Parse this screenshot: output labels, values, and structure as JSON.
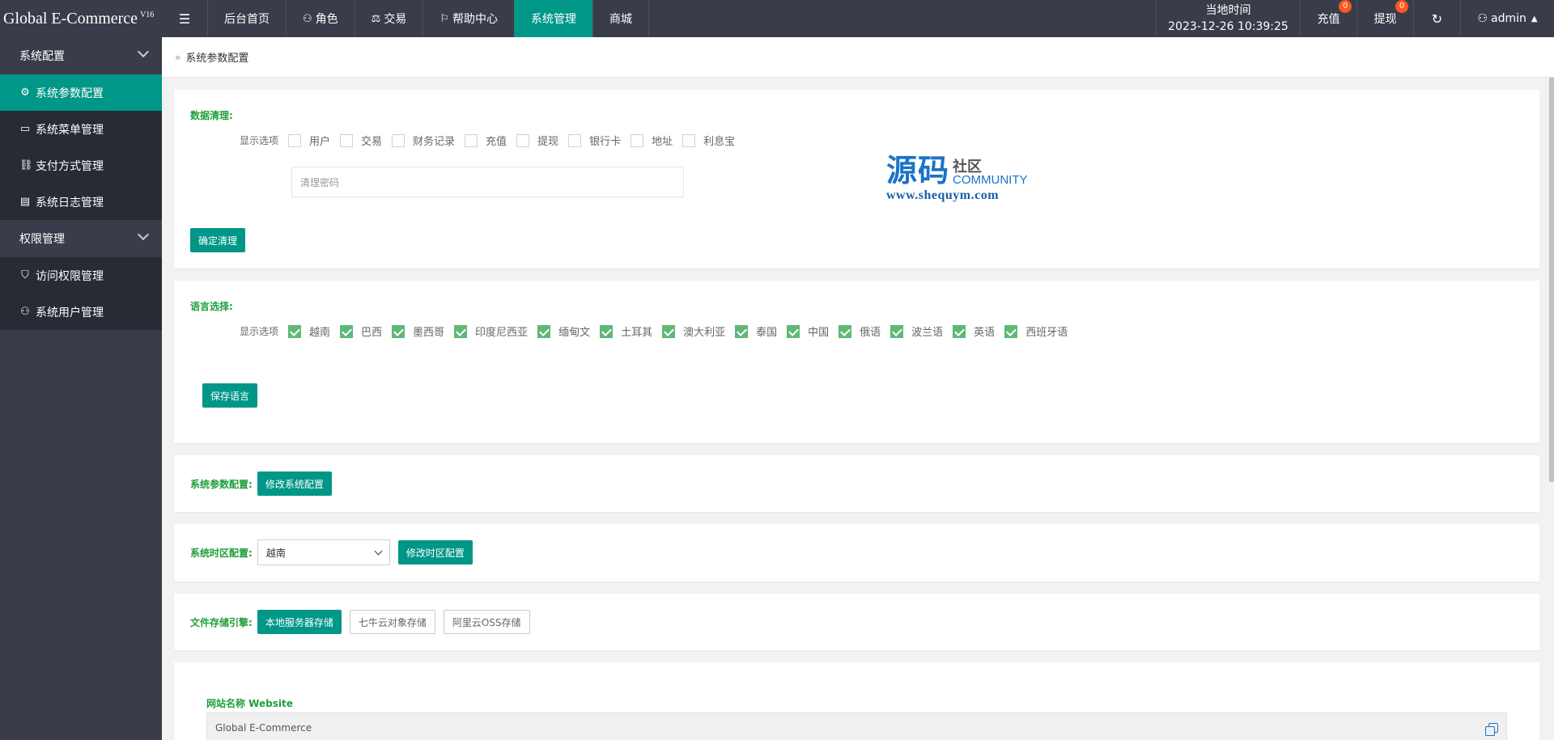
{
  "header": {
    "brand": "Global E-Commerce",
    "version": "V16",
    "toggle_icon": "☰",
    "nav": [
      {
        "label": "后台首页",
        "icon": ""
      },
      {
        "label": "角色",
        "icon": "user-icon"
      },
      {
        "label": "交易",
        "icon": "scale-icon"
      },
      {
        "label": "帮助中心",
        "icon": "flag-icon"
      },
      {
        "label": "系统管理",
        "icon": "",
        "active": true
      },
      {
        "label": "商城",
        "icon": ""
      }
    ],
    "clock_label": "当地时间",
    "clock_value": "2023-12-26 10:39:25",
    "recharge_label": "充值",
    "recharge_badge": "0",
    "withdraw_label": "提现",
    "withdraw_badge": "0",
    "user": "admin"
  },
  "sidebar": {
    "groups": [
      {
        "label": "系统配置",
        "items": [
          {
            "label": "系统参数配置",
            "icon": "gear-icon",
            "active": true
          },
          {
            "label": "系统菜单管理",
            "icon": "window-icon"
          },
          {
            "label": "支付方式管理",
            "icon": "link-icon"
          },
          {
            "label": "系统日志管理",
            "icon": "document-icon"
          }
        ]
      },
      {
        "label": "权限管理",
        "items": [
          {
            "label": "访问权限管理",
            "icon": "shield-icon"
          },
          {
            "label": "系统用户管理",
            "icon": "user-icon"
          }
        ]
      }
    ]
  },
  "breadcrumb": {
    "sep": "»",
    "current": "系统参数配置"
  },
  "data_clear": {
    "title": "数据清理:",
    "options_label": "显示选项",
    "options": [
      "用户",
      "交易",
      "财务记录",
      "充值",
      "提现",
      "银行卡",
      "地址",
      "利息宝"
    ],
    "password_placeholder": "清理密码",
    "confirm_button": "确定清理"
  },
  "watermark": {
    "big": "源码",
    "cn": "社区",
    "en": "COMMUNITY",
    "url": "www.shequym.com"
  },
  "language": {
    "title": "语言选择:",
    "options_label": "显示选项",
    "options": [
      "越南",
      "巴西",
      "墨西哥",
      "印度尼西亚",
      "缅甸文",
      "土耳其",
      "澳大利亚",
      "泰国",
      "中国",
      "俄语",
      "波兰语",
      "英语",
      "西班牙语"
    ],
    "save_button": "保存语言"
  },
  "system_params": {
    "title": "系统参数配置:",
    "button": "修改系统配置"
  },
  "timezone": {
    "title": "系统时区配置:",
    "selected": "越南",
    "button": "修改时区配置"
  },
  "storage": {
    "title": "文件存储引擎:",
    "options": [
      "本地服务器存储",
      "七牛云对象存储",
      "阿里云OSS存储"
    ]
  },
  "website": {
    "label": "网站名称 Website",
    "value": "Global E-Commerce"
  }
}
